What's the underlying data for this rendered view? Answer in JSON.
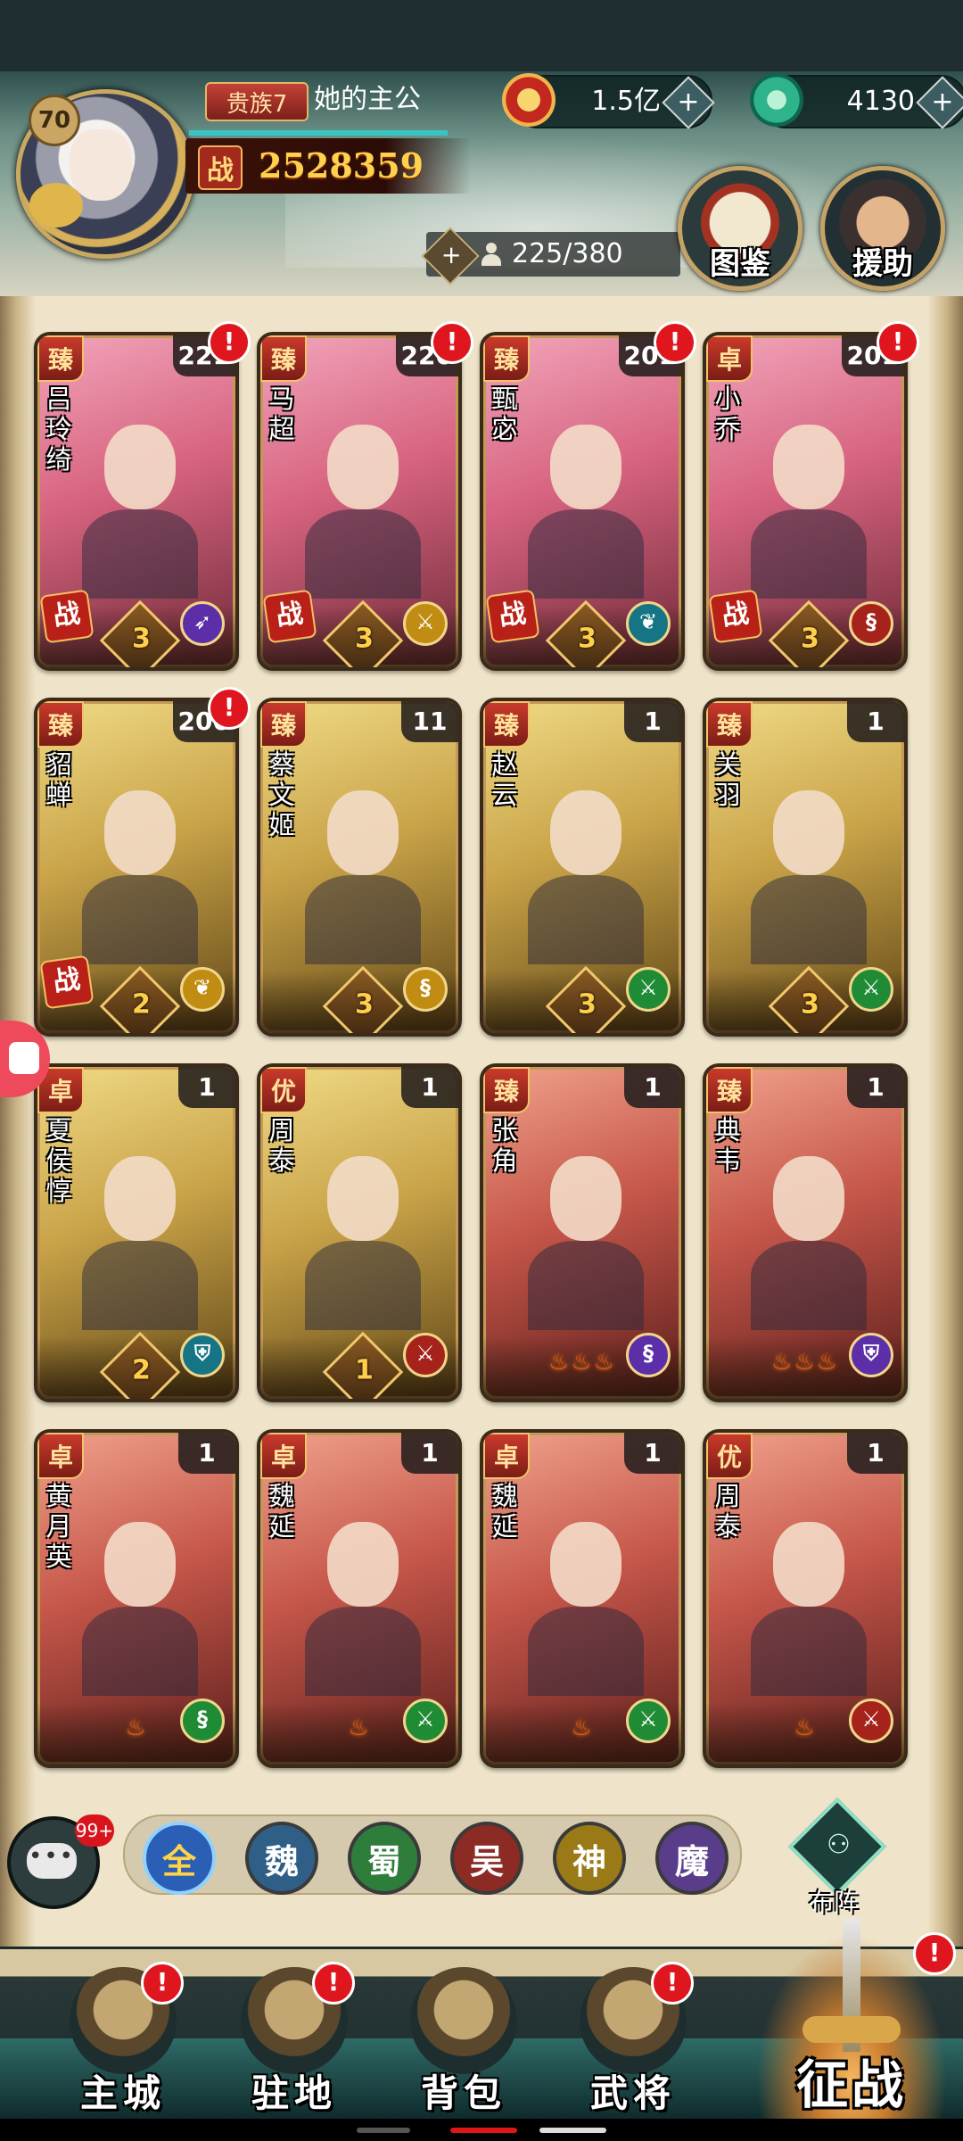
{
  "player": {
    "level": "70",
    "nobility": "贵族7",
    "name": "她的主公",
    "power_tag": "战",
    "power": "2528359",
    "xp_fraction": 1.0
  },
  "currencies": [
    {
      "icon": "copper-coin-icon",
      "value": "1.5亿",
      "plus": "+",
      "color": "#c2281e"
    },
    {
      "icon": "jade-dragon-icon",
      "value": "4130",
      "plus": "+",
      "color": "#2fb38a"
    }
  ],
  "roster_capacity": {
    "plus": "+",
    "value": "225/380"
  },
  "side_buttons": [
    {
      "key": "codex",
      "label": "图鉴"
    },
    {
      "key": "assist",
      "label": "援助"
    }
  ],
  "heroes": [
    {
      "rank": "臻",
      "name": "吕玲绮",
      "level": "221",
      "bg": "pink",
      "alert": "!",
      "battle": "战",
      "class_icon": "archer-icon",
      "class_color": "purple",
      "stars": "3"
    },
    {
      "rank": "臻",
      "name": "马超",
      "level": "220",
      "bg": "pink",
      "alert": "!",
      "battle": "战",
      "class_icon": "lancer-icon",
      "class_color": "yellow",
      "stars": "3"
    },
    {
      "rank": "臻",
      "name": "甄宓",
      "level": "201",
      "bg": "pink",
      "alert": "!",
      "battle": "战",
      "class_icon": "leaf-icon",
      "class_color": "teal",
      "stars": "3"
    },
    {
      "rank": "卓",
      "name": "小乔",
      "level": "201",
      "bg": "pink",
      "alert": "!",
      "battle": "战",
      "class_icon": "strategist-icon",
      "class_color": "red",
      "stars": "3"
    },
    {
      "rank": "臻",
      "name": "貂蝉",
      "level": "200",
      "bg": "gold",
      "alert": "!",
      "battle": "战",
      "class_icon": "leaf-icon",
      "class_color": "yellow",
      "stars": "2"
    },
    {
      "rank": "臻",
      "name": "蔡文姬",
      "level": "11",
      "bg": "gold",
      "alert": "",
      "battle": "",
      "class_icon": "strategist-icon",
      "class_color": "yellow",
      "stars": "3"
    },
    {
      "rank": "臻",
      "name": "赵云",
      "level": "1",
      "bg": "gold",
      "alert": "",
      "battle": "",
      "class_icon": "lancer-icon",
      "class_color": "green",
      "stars": "3"
    },
    {
      "rank": "臻",
      "name": "关羽",
      "level": "1",
      "bg": "gold",
      "alert": "",
      "battle": "",
      "class_icon": "lancer-icon",
      "class_color": "green",
      "stars": "3"
    },
    {
      "rank": "卓",
      "name": "夏侯惇",
      "level": "1",
      "bg": "gold",
      "alert": "",
      "battle": "",
      "class_icon": "shield-icon",
      "class_color": "teal",
      "stars": "2"
    },
    {
      "rank": "优",
      "name": "周泰",
      "level": "1",
      "bg": "gold",
      "alert": "",
      "battle": "",
      "class_icon": "lancer-icon",
      "class_color": "red",
      "stars": "1"
    },
    {
      "rank": "臻",
      "name": "张角",
      "level": "1",
      "bg": "red",
      "alert": "",
      "battle": "",
      "class_icon": "strategist-icon",
      "class_color": "purple",
      "stars": "",
      "flames": "♨♨♨"
    },
    {
      "rank": "臻",
      "name": "典韦",
      "level": "1",
      "bg": "red",
      "alert": "",
      "battle": "",
      "class_icon": "shield-icon",
      "class_color": "purple",
      "stars": "",
      "flames": "♨♨♨"
    },
    {
      "rank": "卓",
      "name": "黄月英",
      "level": "1",
      "bg": "red",
      "alert": "",
      "battle": "",
      "class_icon": "strategist-icon",
      "class_color": "green",
      "stars": "",
      "flames": "♨"
    },
    {
      "rank": "卓",
      "name": "魏延",
      "level": "1",
      "bg": "red",
      "alert": "",
      "battle": "",
      "class_icon": "lancer-icon",
      "class_color": "green",
      "stars": "",
      "flames": "♨"
    },
    {
      "rank": "卓",
      "name": "魏延",
      "level": "1",
      "bg": "red",
      "alert": "",
      "battle": "",
      "class_icon": "lancer-icon",
      "class_color": "green",
      "stars": "",
      "flames": "♨"
    },
    {
      "rank": "优",
      "name": "周泰",
      "level": "1",
      "bg": "red",
      "alert": "",
      "battle": "",
      "class_icon": "lancer-icon",
      "class_color": "red",
      "stars": "",
      "flames": "♨"
    }
  ],
  "chat": {
    "glyph": "•••",
    "badge": "99+"
  },
  "factions": [
    {
      "label": "全",
      "color": "#2a5fb5",
      "text": "#ffd24a",
      "selected": true
    },
    {
      "label": "魏",
      "color": "#2f5f87",
      "text": "#ffffff",
      "selected": false
    },
    {
      "label": "蜀",
      "color": "#2f7d3b",
      "text": "#ffffff",
      "selected": false
    },
    {
      "label": "吴",
      "color": "#8c2a24",
      "text": "#ffffff",
      "selected": false
    },
    {
      "label": "神",
      "color": "#9a7a16",
      "text": "#ffffff",
      "selected": false
    },
    {
      "label": "魔",
      "color": "#5a3d8a",
      "text": "#ffffff",
      "selected": false
    }
  ],
  "formation": {
    "label": "布阵",
    "icon": "troops-icon"
  },
  "bottom_nav": [
    {
      "key": "main-city",
      "label": "主城",
      "alert": "!"
    },
    {
      "key": "garrison",
      "label": "驻地",
      "alert": "!"
    },
    {
      "key": "backpack",
      "label": "背包",
      "alert": ""
    },
    {
      "key": "generals",
      "label": "武将",
      "alert": "!"
    }
  ],
  "campaign": {
    "label": "征战",
    "alert": "!"
  },
  "colors": {
    "accent_gold": "#c9a960",
    "alert_red": "#e0161e",
    "power_gold": "#ffd14d"
  }
}
